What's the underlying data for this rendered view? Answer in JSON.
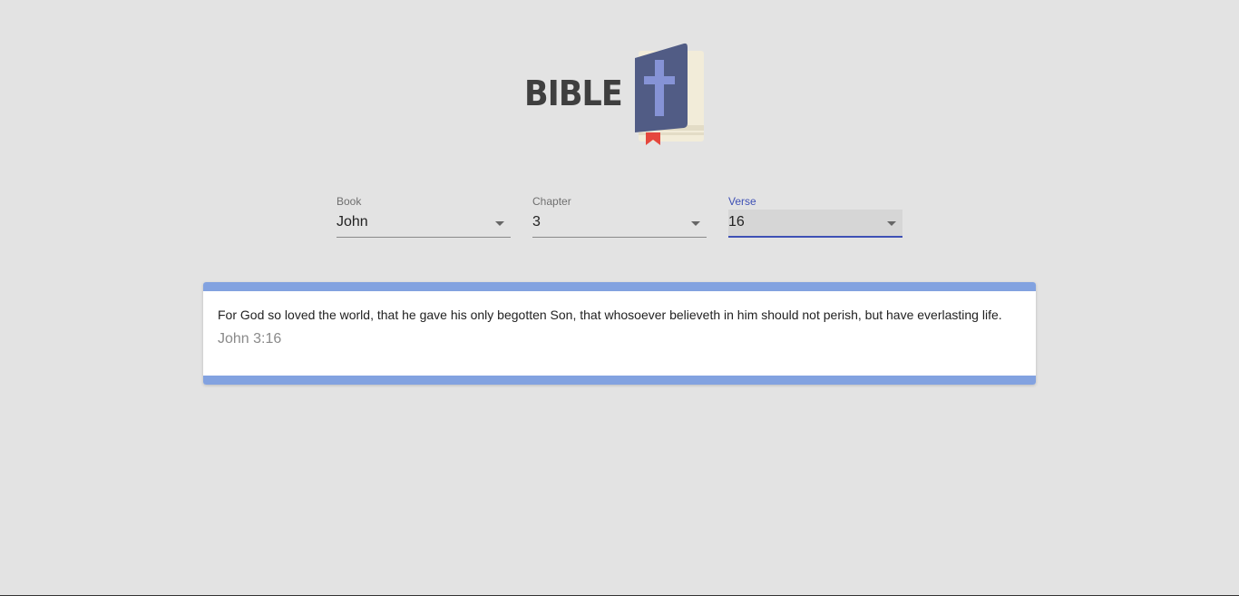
{
  "logo": {
    "text": "BIBLE",
    "icon": "bible-book-cross-icon",
    "colors": {
      "text": "#3f3f3f",
      "cover": "#515c85",
      "cross": "#8693d6",
      "pages": "#f2ecd9",
      "bookmark": "#e5473d"
    }
  },
  "selectors": {
    "book": {
      "label": "Book",
      "value": "John"
    },
    "chapter": {
      "label": "Chapter",
      "value": "3"
    },
    "verse": {
      "label": "Verse",
      "value": "16"
    }
  },
  "verse_card": {
    "text": "For God so loved the world, that he gave his only begotten Son, that whosoever believeth in him should not perish, but have everlasting life.",
    "reference": "John 3:16",
    "accent_color": "#82a2e0"
  },
  "theme": {
    "background": "#e3e3e3",
    "active_color": "#3f51b5"
  }
}
